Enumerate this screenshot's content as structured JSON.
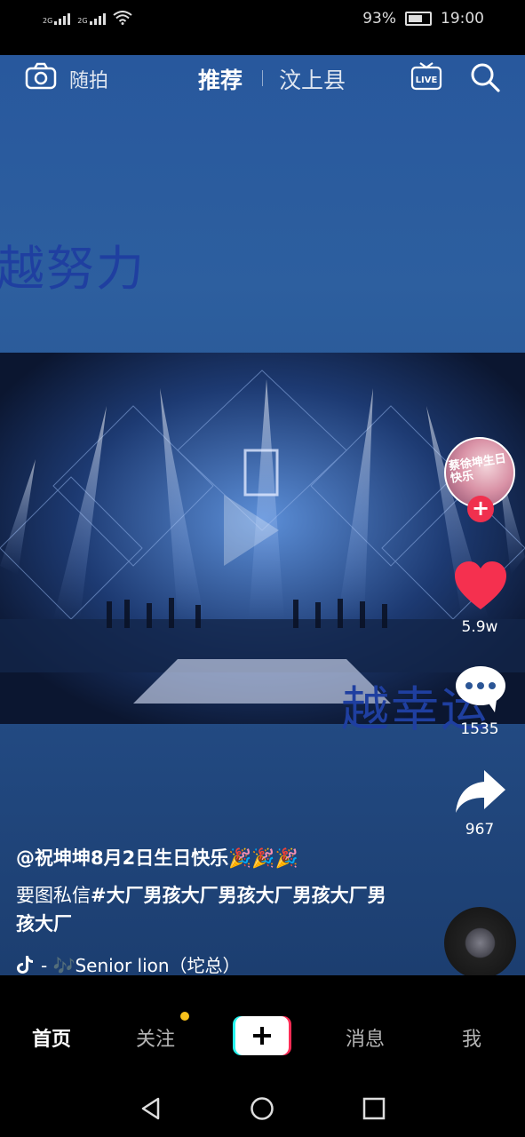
{
  "status": {
    "signal1": "2G",
    "signal2": "2G",
    "battery": "93%",
    "time": "19:00"
  },
  "topnav": {
    "camera_label": "随拍",
    "tab_recommend": "推荐",
    "tab_local": "汶上县",
    "live_label": "LIVE"
  },
  "video": {
    "overlay_top": "越努力",
    "overlay_bottom": "越幸运"
  },
  "sidebar": {
    "avatar_text": "蔡徐坤生日快乐",
    "likes": "5.9w",
    "comments": "1535",
    "shares": "967"
  },
  "post": {
    "author": "@祝坤坤8月2日生日快乐🎉🎉🎉",
    "desc_plain": "要图私信",
    "desc_tag": "#大厂男孩大厂男孩大厂男孩大厂男孩大厂",
    "music": "- 🎶Senior lion（坨总）"
  },
  "tabbar": {
    "home": "首页",
    "follow": "关注",
    "messages": "消息",
    "me": "我"
  },
  "colors": {
    "like": "#f5304f",
    "accent": "#f8c11c"
  }
}
